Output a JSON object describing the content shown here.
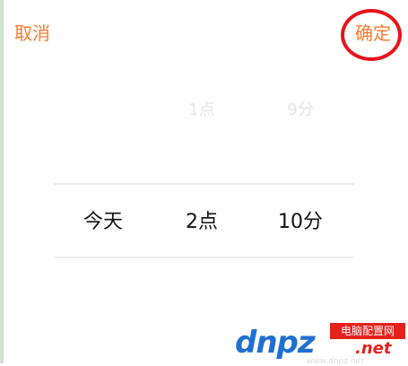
{
  "header": {
    "cancel_label": "取消",
    "confirm_label": "确定"
  },
  "picker": {
    "columns": [
      {
        "name": "day",
        "faded_value": "",
        "selected_value": "今天"
      },
      {
        "name": "hour",
        "faded_value": "1点",
        "selected_value": "2点"
      },
      {
        "name": "minute",
        "faded_value": "9分",
        "selected_value": "10分"
      }
    ]
  },
  "watermark": {
    "logo_text": "dnpz",
    "tag_text": "电脑配置网",
    "domain_suffix": ".net",
    "faint_text": "www.dnpz.net"
  },
  "colors": {
    "accent": "#ff7a2c",
    "highlight_ring": "#e8141b",
    "selected_text": "#111111",
    "faded_text": "#e2e2e2",
    "watermark_blue": "#1f6fd1",
    "watermark_red": "#e5211c"
  }
}
